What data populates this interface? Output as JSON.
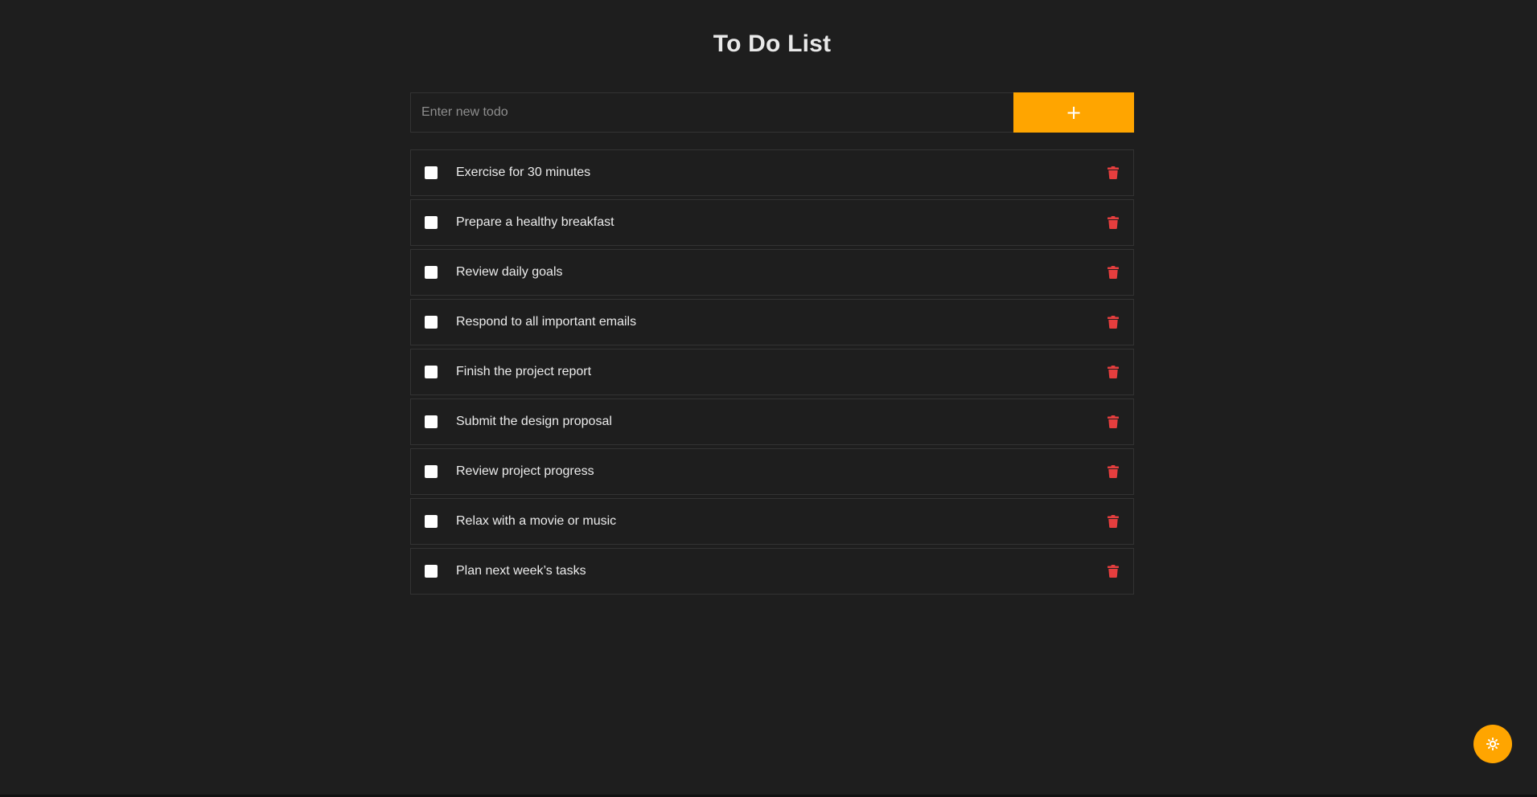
{
  "header": {
    "title": "To Do List"
  },
  "add_form": {
    "placeholder": "Enter new todo",
    "value": "",
    "button_label": "+"
  },
  "todos": [
    {
      "text": "Exercise for 30 minutes",
      "done": false
    },
    {
      "text": "Prepare a healthy breakfast",
      "done": false
    },
    {
      "text": "Review daily goals",
      "done": false
    },
    {
      "text": "Respond to all important emails",
      "done": false
    },
    {
      "text": "Finish the project report",
      "done": false
    },
    {
      "text": "Submit the design proposal",
      "done": false
    },
    {
      "text": "Review project progress",
      "done": false
    },
    {
      "text": "Relax with a movie or music",
      "done": false
    },
    {
      "text": "Plan next week’s tasks",
      "done": false
    }
  ],
  "icons": {
    "delete": "trash-icon",
    "theme_toggle": "sun-icon"
  },
  "colors": {
    "background": "#1e1e1e",
    "accent": "#ffa500",
    "delete": "#e53e3e",
    "border": "#333333"
  }
}
